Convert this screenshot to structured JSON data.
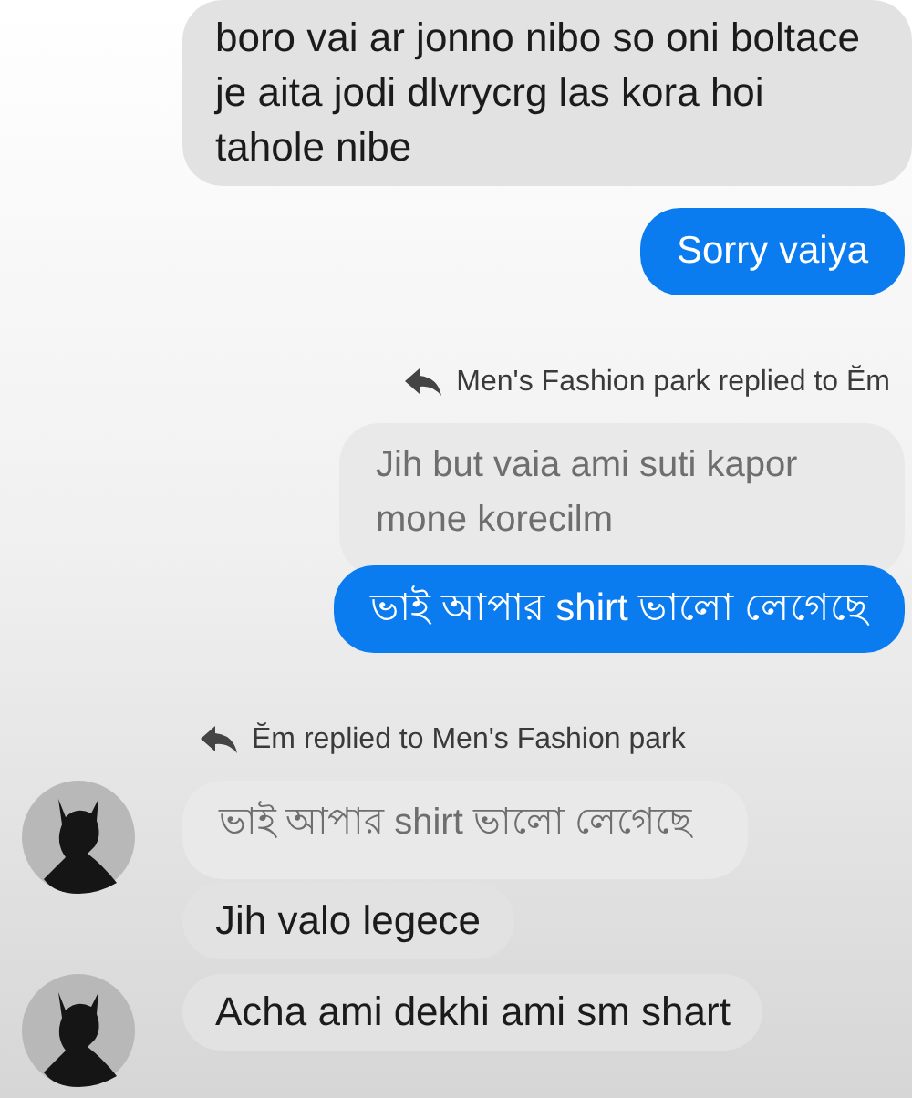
{
  "messages": [
    {
      "kind": "incoming",
      "avatar": false,
      "text": "boro vai ar jonno nibo so oni boltace je aita jodi dlvrycrg las kora hoi tahole nibe"
    },
    {
      "kind": "outgoing",
      "text": "Sorry vaiya"
    },
    {
      "kind": "outnote",
      "text": "Men's Fashion park replied to Ĕm"
    },
    {
      "kind": "outquote",
      "text": "Jih but vaia ami suti kapor mone korecilm"
    },
    {
      "kind": "outgoing",
      "text": "ভাই আপার shirt ভালো লেগেছে"
    },
    {
      "kind": "innote",
      "text": "Ĕm replied to Men's Fashion park"
    },
    {
      "kind": "inquote",
      "avatar": true,
      "text": "ভাই আপার shirt ভালো লেগেছে"
    },
    {
      "kind": "incoming",
      "avatar": false,
      "text": "Jih valo legece"
    },
    {
      "kind": "incoming",
      "avatar": true,
      "text": "Acha ami dekhi ami sm shart"
    }
  ]
}
